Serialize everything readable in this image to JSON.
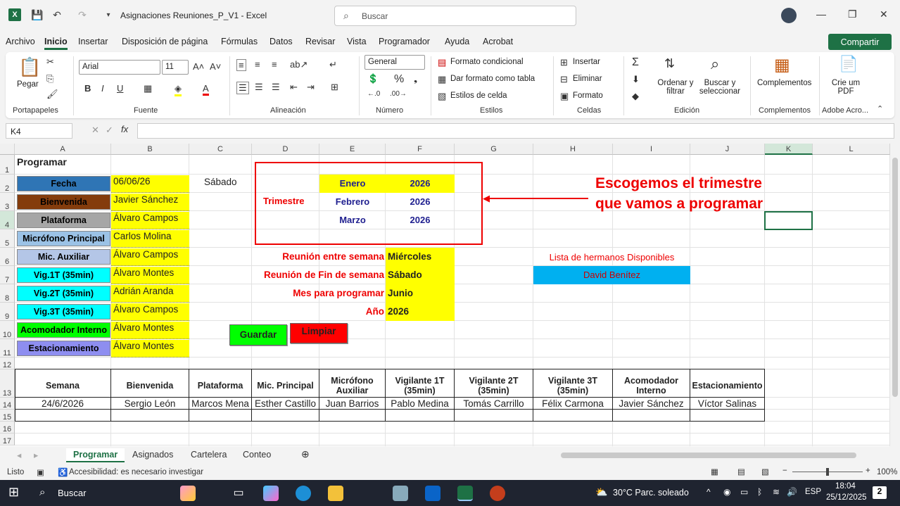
{
  "window": {
    "title": "Asignaciones Reuniones_P_V1  -  Excel",
    "search_placeholder": "Buscar"
  },
  "menu": [
    "Archivo",
    "Inicio",
    "Insertar",
    "Disposición de página",
    "Fórmulas",
    "Datos",
    "Revisar",
    "Vista",
    "Programador",
    "Ayuda",
    "Acrobat"
  ],
  "share_label": "Compartir",
  "ribbon": {
    "paste": "Pegar",
    "font_name": "Arial",
    "font_size": "11",
    "number_format": "General",
    "cond_format": "Formato condicional",
    "table_format": "Dar formato como tabla",
    "cell_styles": "Estilos de celda",
    "insert": "Insertar",
    "delete": "Eliminar",
    "format": "Formato",
    "sort": "Ordenar y filtrar",
    "find": "Buscar y seleccionar",
    "addins": "Complementos",
    "pdf": "Crie um PDF",
    "groups": [
      "Portapapeles",
      "Fuente",
      "Alineación",
      "Número",
      "Estilos",
      "Celdas",
      "Edición",
      "Complementos",
      "Adobe Acro..."
    ]
  },
  "namebox": "K4",
  "columns": [
    "A",
    "B",
    "C",
    "D",
    "E",
    "F",
    "G",
    "H",
    "I",
    "J",
    "K",
    "L"
  ],
  "rows": [
    "1",
    "2",
    "3",
    "4",
    "5",
    "6",
    "7",
    "8",
    "9",
    "10",
    "11",
    "12",
    "13",
    "14",
    "15",
    "16",
    "17"
  ],
  "programar_title": "Programar",
  "roles": [
    {
      "label": "Fecha",
      "value": "06/06/26",
      "color": "#2f75b5"
    },
    {
      "label": "Bienvenida",
      "value": "Javier Sánchez",
      "color": "#843c0c"
    },
    {
      "label": "Plataforma",
      "value": "Álvaro Campos",
      "color": "#a6a6a6"
    },
    {
      "label": "Micrófono Principal",
      "value": "Carlos Molina",
      "color": "#9bc2e6"
    },
    {
      "label": "Mic. Auxiliar",
      "value": "Álvaro Campos",
      "color": "#b4c6e7"
    },
    {
      "label": "Vig.1T (35min)",
      "value": "Álvaro Montes",
      "color": "#00ffff"
    },
    {
      "label": "Vig.2T (35min)",
      "value": "Adrián Aranda",
      "color": "#00ffff"
    },
    {
      "label": "Vig.3T (35min)",
      "value": "Álvaro Campos",
      "color": "#00ffff"
    },
    {
      "label": "Acomodador Interno",
      "value": "Álvaro Montes",
      "color": "#00ff00"
    },
    {
      "label": "Estacionamiento",
      "value": "Álvaro Montes",
      "color": "#8e8ef0"
    }
  ],
  "day_label": "Sábado",
  "trimestre": {
    "label": "Trimestre",
    "months": [
      {
        "m": "Enero",
        "y": "2026"
      },
      {
        "m": "Febrero",
        "y": "2026"
      },
      {
        "m": "Marzo",
        "y": "2026"
      }
    ]
  },
  "annotation": "Escogemos el trimestre que vamos a programar",
  "params": [
    {
      "label": "Reunión entre semana",
      "value": "Miércoles"
    },
    {
      "label": "Reunión de Fin de semana",
      "value": "Sábado"
    },
    {
      "label": "Mes para programar",
      "value": "Junio"
    },
    {
      "label": "Año",
      "value": "2026"
    }
  ],
  "lista": {
    "title": "Lista de hermanos Disponibles",
    "item": "David Benítez"
  },
  "buttons": {
    "guardar": "Guardar",
    "limpiar": "Limpiar"
  },
  "table": {
    "headers": [
      "Semana",
      "Bienvenida",
      "Plataforma",
      "Mic. Principal",
      "Micrófono Auxiliar",
      "Vigilante 1T (35min)",
      "Vigilante 2T (35min)",
      "Vigilante 3T (35min)",
      "Acomodador Interno",
      "Estacionamiento"
    ],
    "row": [
      "24/6/2026",
      "Sergio León",
      "Marcos Mena",
      "Esther Castillo",
      "Juan Barrios",
      "Pablo Medina",
      "Tomás Carrillo",
      "Félix Carmona",
      "Javier Sánchez",
      "Víctor Salinas"
    ]
  },
  "sheets": [
    "Programar",
    "Asignados",
    "Cartelera",
    "Conteo"
  ],
  "status": {
    "ready": "Listo",
    "accessibility": "Accesibilidad: es necesario investigar",
    "zoom": "100%"
  },
  "taskbar": {
    "search": "Buscar",
    "weather": "30°C  Parc. soleado",
    "lang": "ESP",
    "time": "18:04",
    "date": "25/12/2025",
    "badge": "2"
  }
}
